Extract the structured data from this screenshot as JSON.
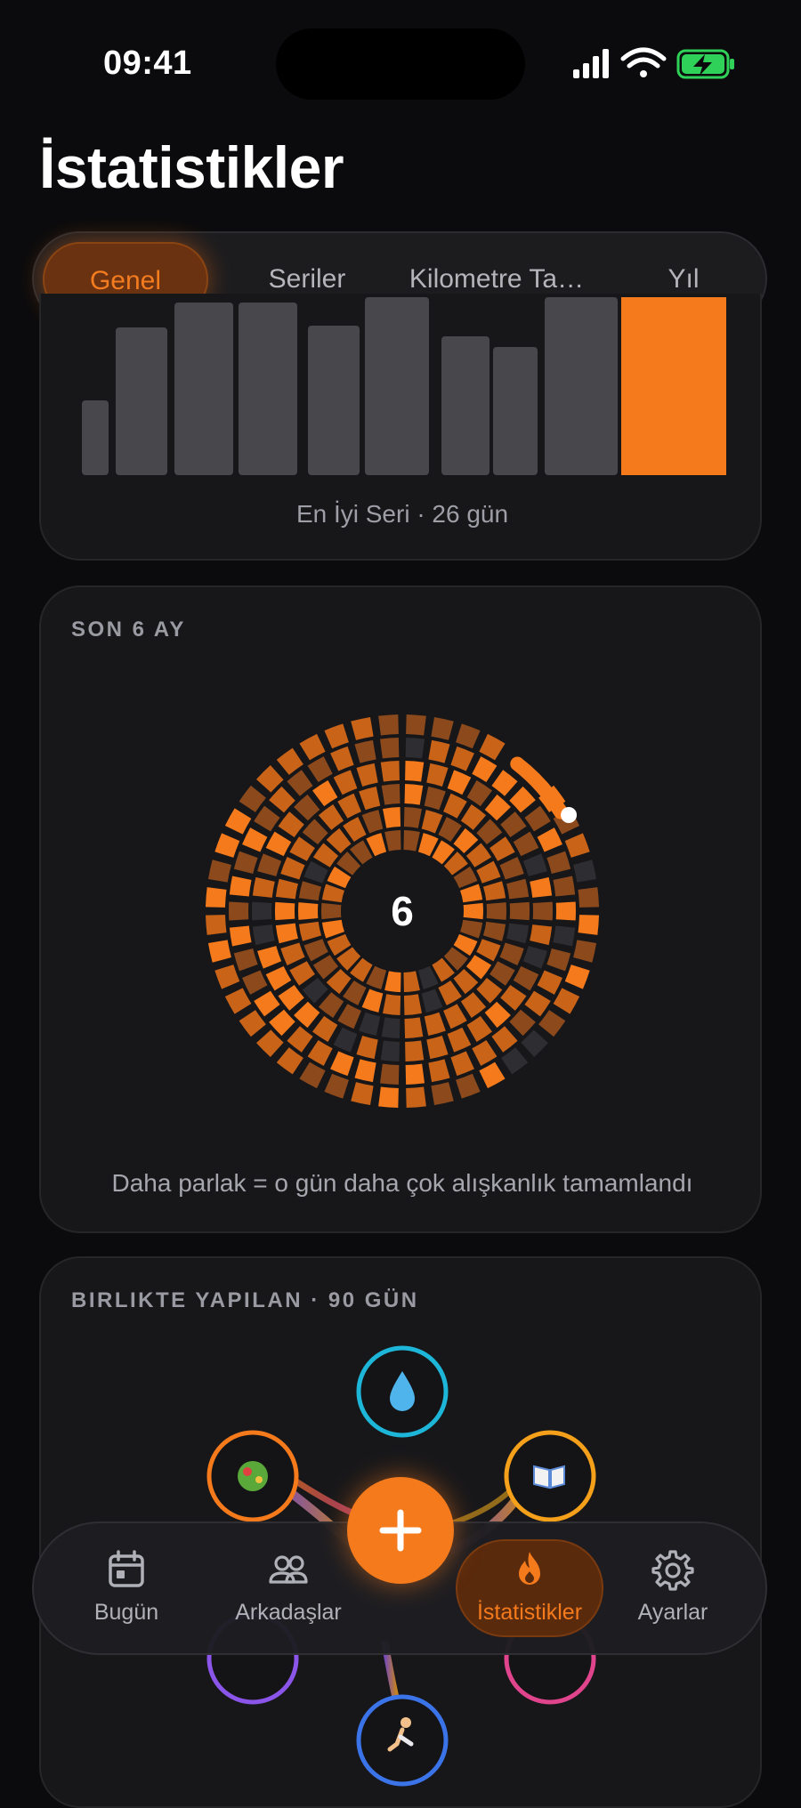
{
  "status_bar": {
    "time": "09:41"
  },
  "page_title": "İstatistikler",
  "tabs": [
    {
      "label": "Genel",
      "active": true
    },
    {
      "label": "Seriler",
      "active": false
    },
    {
      "label": "Kilometre Ta…",
      "active": false
    },
    {
      "label": "Yıl",
      "active": false
    }
  ],
  "streak_card": {
    "caption": "En İyi Seri · 26 gün",
    "bar_relative_heights": [
      0.42,
      0.83,
      0.97,
      0.97,
      0.84,
      1.0,
      0.78,
      0.72,
      1.0,
      1.0
    ],
    "highlight_index": 9,
    "colors": {
      "bar": "#48484c",
      "highlight": "#f47a1c"
    }
  },
  "ring_card": {
    "label": "SON 6 AY",
    "center_value": "6",
    "caption": "Daha parlak = o gün daha çok alışkanlık tamamlandı",
    "colors": {
      "bright": "#f47a1c",
      "mid": "#c96318",
      "dim": "#8c4a1c",
      "empty": "#2e2e32"
    }
  },
  "co_card": {
    "label": "BIRLIKTE YAPILAN · 90 GÜN",
    "nodes": [
      {
        "icon": "droplet-icon",
        "glyph": "💧",
        "color": "#1db6d8"
      },
      {
        "icon": "salad-icon",
        "glyph": "🥗",
        "color": "#f47a1c"
      },
      {
        "icon": "book-icon",
        "glyph": "📖",
        "color": "#f5a01a"
      },
      {
        "icon": "yoga-icon",
        "glyph": "",
        "color": "#8a55e8"
      },
      {
        "icon": "heart-icon",
        "glyph": "",
        "color": "#e0448c"
      },
      {
        "icon": "running-icon",
        "glyph": "🏃",
        "color": "#3a74e8"
      }
    ]
  },
  "bottom_nav": {
    "items": [
      {
        "label": "Bugün",
        "icon": "calendar-icon"
      },
      {
        "label": "Arkadaşlar",
        "icon": "friends-icon"
      },
      {
        "label": "İstatistikler",
        "icon": "flame-icon",
        "active": true
      },
      {
        "label": "Ayarlar",
        "icon": "gear-icon"
      }
    ],
    "accent": "#f47a1c"
  }
}
